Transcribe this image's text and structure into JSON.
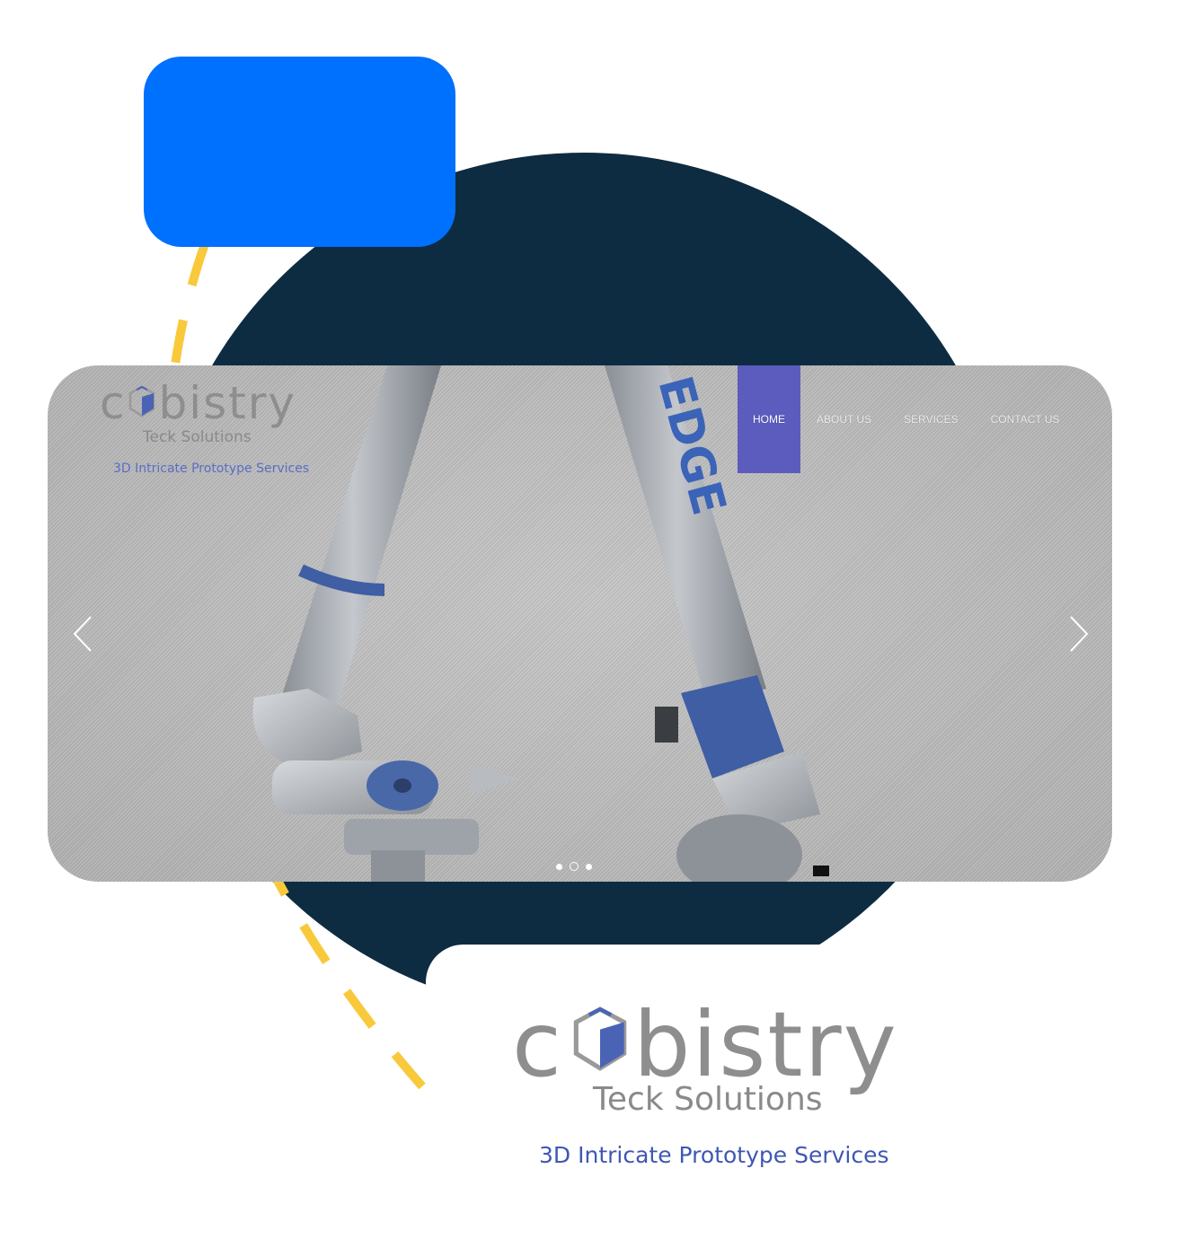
{
  "brand": {
    "name": "cubistry",
    "name_prefix": "c",
    "name_suffix": "bistry",
    "subtitle": "Teck Solutions",
    "tagline": "3D Intricate Prototype Services"
  },
  "nav": {
    "items": [
      {
        "label": "HOME",
        "active": true
      },
      {
        "label": "ABOUT US",
        "active": false
      },
      {
        "label": "SERVICES",
        "active": false
      },
      {
        "label": "CONTACT US",
        "active": false
      }
    ]
  },
  "slider": {
    "product_text": "EDGE",
    "slide_count": 3,
    "current_slide": 2
  },
  "icons": {
    "prev": "chevron-left-icon",
    "next": "chevron-right-icon",
    "logo_mark": "cube-icon"
  },
  "colors": {
    "navy": "#0e2c41",
    "blue_tile": "#0070ff",
    "dash_yellow": "#f9c93c",
    "nav_active": "#5c5cbf",
    "tagline_blue": "#3f57b3",
    "logo_gray": "#8e8e8e",
    "cube_blue": "#4a63b5"
  }
}
